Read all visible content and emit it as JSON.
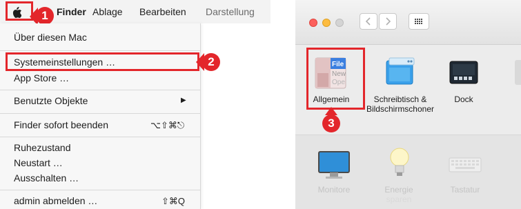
{
  "menubar": {
    "apple_menu": "apple-logo-icon",
    "items": [
      "Finder",
      "Ablage",
      "Bearbeiten",
      "Darstellung"
    ]
  },
  "apple_menu": {
    "items": [
      {
        "label": "Über diesen Mac"
      },
      {
        "label": "Systemeinstellungen …"
      },
      {
        "label": "App Store …"
      },
      {
        "label": "Benutzte Objekte",
        "submenu_indicator": "▶"
      },
      {
        "label": "Finder sofort beenden",
        "shortcut": "⌥⇧⌘⎋"
      },
      {
        "label": "Ruhezustand"
      },
      {
        "label": "Neustart …"
      },
      {
        "label": "Ausschalten …"
      },
      {
        "label": "admin abmelden …",
        "shortcut": "⇧⌘Q"
      }
    ]
  },
  "callouts": {
    "step1": "1",
    "step2": "2",
    "step3": "3"
  },
  "sysprefs": {
    "toolbar": {
      "close": "close-button",
      "minimize": "minimize-button",
      "zoom": "zoom-button",
      "back": "back-chevron-icon",
      "forward": "forward-chevron-icon",
      "show_all": "grid-icon"
    },
    "row1": [
      {
        "label": "Allgemein",
        "icon": "general-icon",
        "icon_text": [
          "File",
          "New",
          "Ope"
        ]
      },
      {
        "label_line1": "Schreibtisch &",
        "label_line2": "Bildschirmschoner",
        "icon": "desktop-screensaver-icon"
      },
      {
        "label": "Dock",
        "icon": "dock-icon"
      }
    ],
    "row2": [
      {
        "label": "Monitore",
        "icon": "monitor-icon"
      },
      {
        "label": "Energie",
        "sublabel": "sparen",
        "icon": "lightbulb-icon"
      },
      {
        "label": "Tastatur",
        "icon": "keyboard-icon"
      }
    ]
  },
  "colors": {
    "highlight": "#e3262b",
    "close": "#fc605c",
    "minimize": "#fdbc40",
    "zoom": "#cfcfcf"
  }
}
